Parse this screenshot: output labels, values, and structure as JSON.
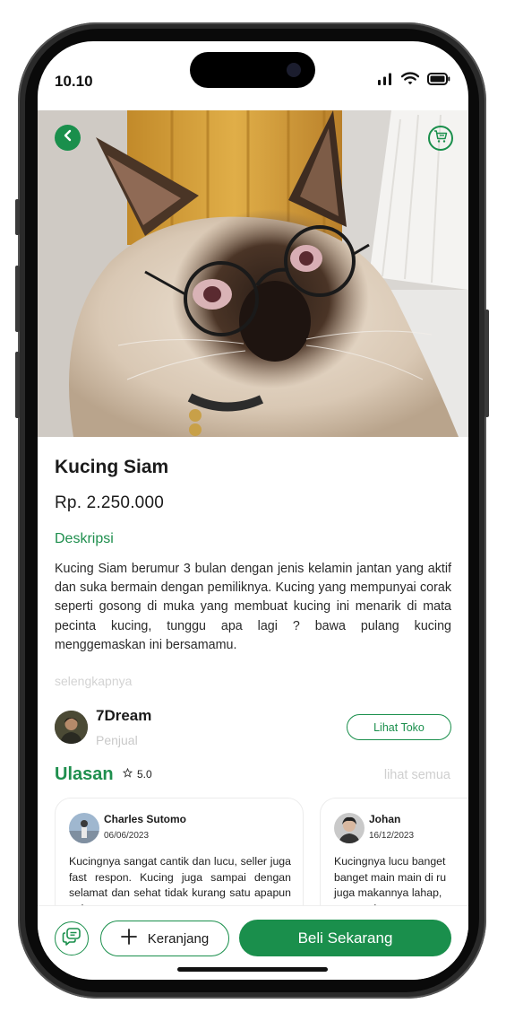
{
  "status_bar": {
    "time": "10.10"
  },
  "product": {
    "name": "Kucing Siam",
    "price": "Rp. 2.250.000",
    "description_heading": "Deskripsi",
    "description": "Kucing Siam berumur 3 bulan dengan jenis kelamin jantan yang aktif dan suka bermain dengan pemiliknya. Kucing yang mempunyai corak seperti gosong di muka yang membuat kucing ini menarik di mata pecinta kucing, tunggu apa lagi ? bawa pulang kucing menggemaskan ini bersamamu.",
    "read_more": "selengkapnya"
  },
  "seller": {
    "name": "7Dream",
    "role": "Penjual",
    "shop_button": "Lihat Toko"
  },
  "reviews": {
    "heading": "Ulasan",
    "rating": "5.0",
    "see_all": "lihat semua",
    "items": [
      {
        "name": "Charles Sutomo",
        "date": "06/06/2023",
        "text": "Kucingnya sangat cantik dan lucu, seller juga fast respon. Kucing juga sampai dengan selamat dan sehat tidak kurang satu apapun pelayanan"
      },
      {
        "name": "Johan",
        "date": "16/12/2023",
        "text_lines": [
          "Kucingnya lucu banget",
          "banget main main di ru",
          "juga makannya lahap,",
          "sangat dan terpercaya"
        ]
      }
    ]
  },
  "actions": {
    "cart_label": "Keranjang",
    "buy_label": "Beli Sekarang"
  },
  "colors": {
    "accent": "#1a8f4c",
    "muted_text": "#cfcfcf"
  },
  "icons": [
    "back-icon",
    "cart-icon",
    "chat-icon",
    "plus-icon",
    "star-icon",
    "signal-icon",
    "wifi-icon",
    "battery-icon"
  ]
}
